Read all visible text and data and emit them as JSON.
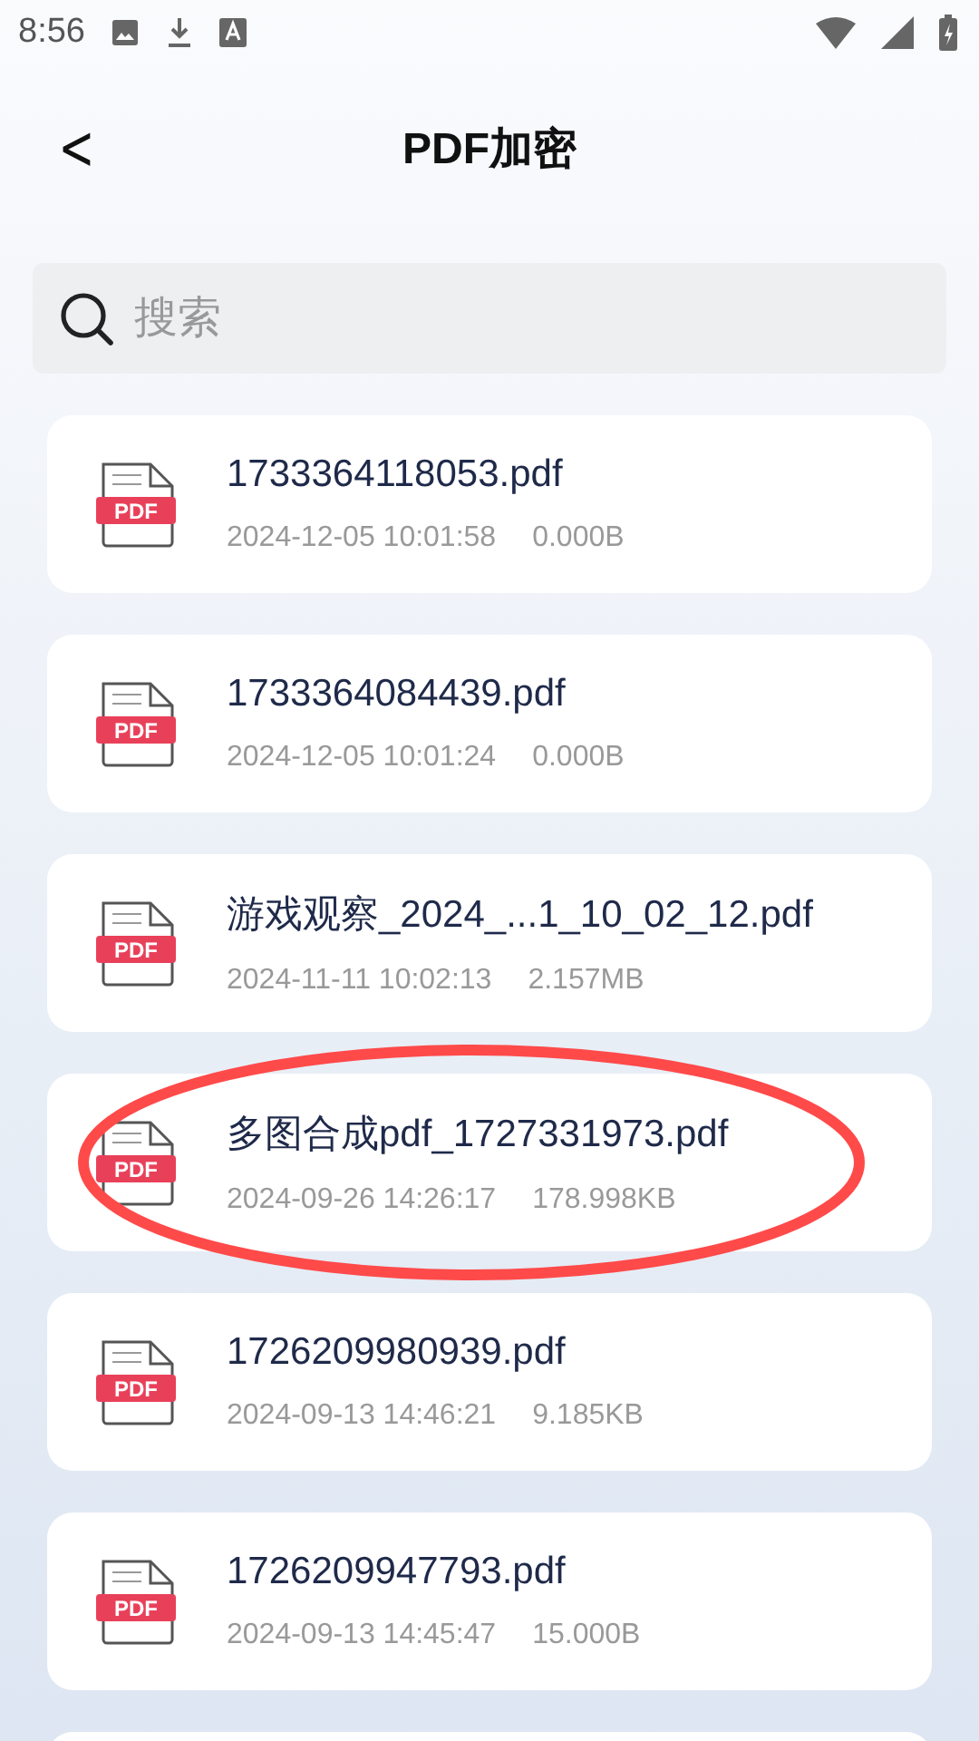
{
  "status_bar": {
    "time": "8:56"
  },
  "header": {
    "back": "<",
    "title": "PDF加密"
  },
  "search": {
    "placeholder": "搜索"
  },
  "files": [
    {
      "icon_label": "PDF",
      "name": "1733364118053.pdf",
      "date": "2024-12-05 10:01:58",
      "size": "0.000B",
      "circled": false
    },
    {
      "icon_label": "PDF",
      "name": "1733364084439.pdf",
      "date": "2024-12-05 10:01:24",
      "size": "0.000B",
      "circled": false
    },
    {
      "icon_label": "PDF",
      "name": "游戏观察_2024_...1_10_02_12.pdf",
      "date": "2024-11-11 10:02:13",
      "size": "2.157MB",
      "circled": false
    },
    {
      "icon_label": "PDF",
      "name": "多图合成pdf_1727331973.pdf",
      "date": "2024-09-26 14:26:17",
      "size": "178.998KB",
      "circled": true
    },
    {
      "icon_label": "PDF",
      "name": "1726209980939.pdf",
      "date": "2024-09-13 14:46:21",
      "size": "9.185KB",
      "circled": false
    },
    {
      "icon_label": "PDF",
      "name": "1726209947793.pdf",
      "date": "2024-09-13 14:45:47",
      "size": "15.000B",
      "circled": false
    }
  ]
}
